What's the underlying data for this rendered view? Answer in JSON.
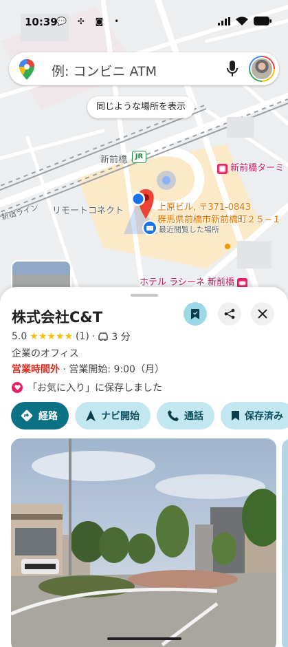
{
  "status_bar": {
    "time": "10:39",
    "notifications": "💬 ✣ ◙ •"
  },
  "search": {
    "placeholder": "例: コンビニ ATM"
  },
  "map": {
    "similar_places_chip": "同じような場所を表示",
    "labels": {
      "station": "新前橋",
      "jr_badge": "JR",
      "terminal": "新前橋ターミ",
      "place_name": "リモートコネクト",
      "building": "上原ビル, 〒371-0843",
      "address": "群馬県前橋市新前橋町２５−１",
      "recent": "最近閲覧した場所",
      "hotel": "ホテル ラシーネ 新前橋",
      "line": "新宿ライン"
    }
  },
  "place": {
    "name": "株式会社C&T",
    "rating": "5.0",
    "stars": "★★★★★",
    "review_count": "(1)",
    "drive_time": "3 分",
    "category": "企業のオフィス",
    "status": "営業時間外",
    "hours_detail": " · 営業開始: 9:00（月）",
    "saved_message": "「お気に入り」に保存しました"
  },
  "actions": [
    {
      "label": "経路"
    },
    {
      "label": "ナビ開始"
    },
    {
      "label": "通話"
    },
    {
      "label": "保存済み"
    }
  ],
  "colors": {
    "accent": "#0b7285",
    "chip": "#c2e7f1",
    "closed": "#d93025",
    "pin": "#ea4335"
  }
}
